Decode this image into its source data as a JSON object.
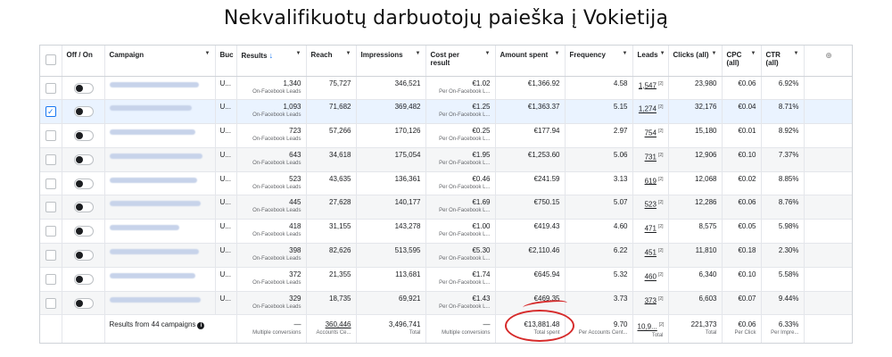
{
  "page": {
    "title": "Nekvalifikuotų darbuotojų paieška į Vokietiją"
  },
  "colors": {
    "accent": "#1877f2",
    "annotation": "#d62b2b"
  },
  "header": {
    "off_on": "Off / On",
    "campaign": "Campaign",
    "budget": "Buc",
    "results": "Results",
    "reach": "Reach",
    "impressions": "Impressions",
    "cost_per_result": "Cost per result",
    "amount_spent": "Amount spent",
    "frequency": "Frequency",
    "leads": "Leads",
    "clicks": "Clicks (all)",
    "cpc": "CPC (all)",
    "ctr": "CTR (all)",
    "add_column_icon": "circle-plus-icon"
  },
  "rows": [
    {
      "budget": "U...",
      "results": "1,340",
      "results_sub": "On-Facebook Leads",
      "reach": "75,727",
      "impressions": "346,521",
      "cpr": "€1.02",
      "cpr_sub": "Per On-Facebook L...",
      "spent": "€1,366.92",
      "frequency": "4.58",
      "leads": "1,547",
      "clicks": "23,980",
      "cpc": "€0.06",
      "ctr": "6.92%"
    },
    {
      "budget": "U...",
      "results": "1,093",
      "results_sub": "On-Facebook Leads",
      "reach": "71,682",
      "impressions": "369,482",
      "cpr": "€1.25",
      "cpr_sub": "Per On-Facebook L...",
      "spent": "€1,363.37",
      "frequency": "5.15",
      "leads": "1,274",
      "clicks": "32,176",
      "cpc": "€0.04",
      "ctr": "8.71%"
    },
    {
      "budget": "U...",
      "results": "723",
      "results_sub": "On-Facebook Leads",
      "reach": "57,266",
      "impressions": "170,126",
      "cpr": "€0.25",
      "cpr_sub": "Per On-Facebook L...",
      "spent": "€177.94",
      "frequency": "2.97",
      "leads": "754",
      "clicks": "15,180",
      "cpc": "€0.01",
      "ctr": "8.92%"
    },
    {
      "budget": "U...",
      "results": "643",
      "results_sub": "On-Facebook Leads",
      "reach": "34,618",
      "impressions": "175,054",
      "cpr": "€1.95",
      "cpr_sub": "Per On-Facebook L...",
      "spent": "€1,253.60",
      "frequency": "5.06",
      "leads": "731",
      "clicks": "12,906",
      "cpc": "€0.10",
      "ctr": "7.37%"
    },
    {
      "budget": "U...",
      "results": "523",
      "results_sub": "On-Facebook Leads",
      "reach": "43,635",
      "impressions": "136,361",
      "cpr": "€0.46",
      "cpr_sub": "Per On-Facebook L...",
      "spent": "€241.59",
      "frequency": "3.13",
      "leads": "619",
      "clicks": "12,068",
      "cpc": "€0.02",
      "ctr": "8.85%"
    },
    {
      "budget": "U...",
      "results": "445",
      "results_sub": "On-Facebook Leads",
      "reach": "27,628",
      "impressions": "140,177",
      "cpr": "€1.69",
      "cpr_sub": "Per On-Facebook L...",
      "spent": "€750.15",
      "frequency": "5.07",
      "leads": "523",
      "clicks": "12,286",
      "cpc": "€0.06",
      "ctr": "8.76%"
    },
    {
      "budget": "U...",
      "results": "418",
      "results_sub": "On-Facebook Leads",
      "reach": "31,155",
      "impressions": "143,278",
      "cpr": "€1.00",
      "cpr_sub": "Per On-Facebook L...",
      "spent": "€419.43",
      "frequency": "4.60",
      "leads": "471",
      "clicks": "8,575",
      "cpc": "€0.05",
      "ctr": "5.98%"
    },
    {
      "budget": "U...",
      "results": "398",
      "results_sub": "On-Facebook Leads",
      "reach": "82,626",
      "impressions": "513,595",
      "cpr": "€5.30",
      "cpr_sub": "Per On-Facebook L...",
      "spent": "€2,110.46",
      "frequency": "6.22",
      "leads": "451",
      "clicks": "11,810",
      "cpc": "€0.18",
      "ctr": "2.30%"
    },
    {
      "budget": "U...",
      "results": "372",
      "results_sub": "On-Facebook Leads",
      "reach": "21,355",
      "impressions": "113,681",
      "cpr": "€1.74",
      "cpr_sub": "Per On-Facebook L...",
      "spent": "€645.94",
      "frequency": "5.32",
      "leads": "460",
      "clicks": "6,340",
      "cpc": "€0.10",
      "ctr": "5.58%"
    },
    {
      "budget": "U...",
      "results": "329",
      "results_sub": "On-Facebook Leads",
      "reach": "18,735",
      "impressions": "69,921",
      "cpr": "€1.43",
      "cpr_sub": "Per On-Facebook L...",
      "spent": "€469.35",
      "frequency": "3.73",
      "leads": "373",
      "clicks": "6,603",
      "cpc": "€0.07",
      "ctr": "9.44%"
    }
  ],
  "leads_superscript": "[2]",
  "selected_row_index": 1,
  "footer": {
    "label": "Results from 44 campaigns",
    "results": "—",
    "results_sub": "Multiple conversions",
    "reach": "360,446",
    "reach_sub": "Accounts Ce...",
    "impressions": "3,496,741",
    "impressions_sub": "Total",
    "cpr": "—",
    "cpr_sub": "Multiple conversions",
    "spent": "€13,881.48",
    "spent_sub": "Total spent",
    "frequency": "9.70",
    "frequency_sub": "Per Accounts Cent...",
    "leads": "10,9...",
    "leads_sub": "Total",
    "clicks": "221,373",
    "clicks_sub": "Total",
    "cpc": "€0.06",
    "cpc_sub": "Per Click",
    "ctr": "6.33%",
    "ctr_sub": "Per Impre..."
  }
}
